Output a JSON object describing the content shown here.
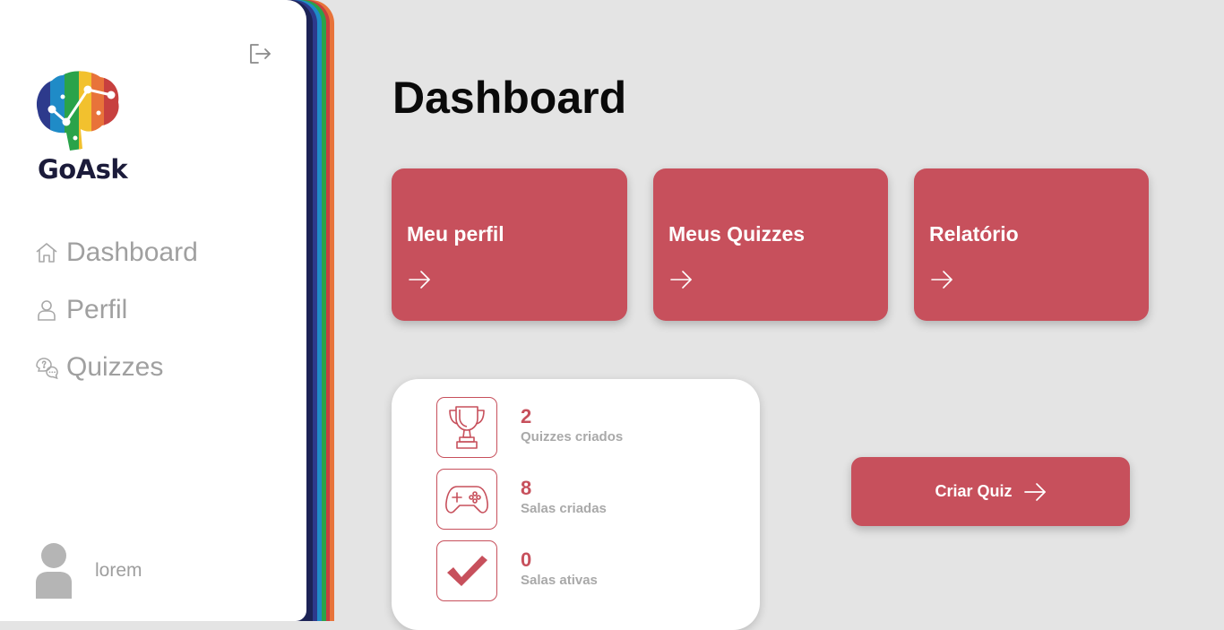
{
  "app": {
    "brand": "GoAsk"
  },
  "sidebar": {
    "items": [
      {
        "label": "Dashboard",
        "icon": "home-icon"
      },
      {
        "label": "Perfil",
        "icon": "user-icon"
      },
      {
        "label": "Quizzes",
        "icon": "chat-question-icon"
      }
    ],
    "user": {
      "name": "lorem"
    }
  },
  "main": {
    "title": "Dashboard",
    "cards": [
      {
        "title": "Meu perfil",
        "icon": "arrow-right-icon"
      },
      {
        "title": "Meus Quizzes",
        "icon": "arrow-right-icon"
      },
      {
        "title": "Relatório",
        "icon": "arrow-right-icon"
      }
    ],
    "stats": [
      {
        "value": "2",
        "label": "Quizzes criados",
        "icon": "trophy-icon"
      },
      {
        "value": "8",
        "label": "Salas criadas",
        "icon": "gamepad-icon"
      },
      {
        "value": "0",
        "label": "Salas ativas",
        "icon": "check-icon"
      }
    ],
    "cta": {
      "label": "Criar Quiz",
      "icon": "arrow-right-icon"
    }
  },
  "colors": {
    "accent": "#c7505c",
    "background": "#e4e4e4",
    "sidebar": "#ffffff",
    "muted_text": "#a0a0a0",
    "stripe": [
      "#e8733a",
      "#c7403f",
      "#2aa34a",
      "#1f8bc7",
      "#2d3a8c",
      "#1c2356"
    ]
  }
}
